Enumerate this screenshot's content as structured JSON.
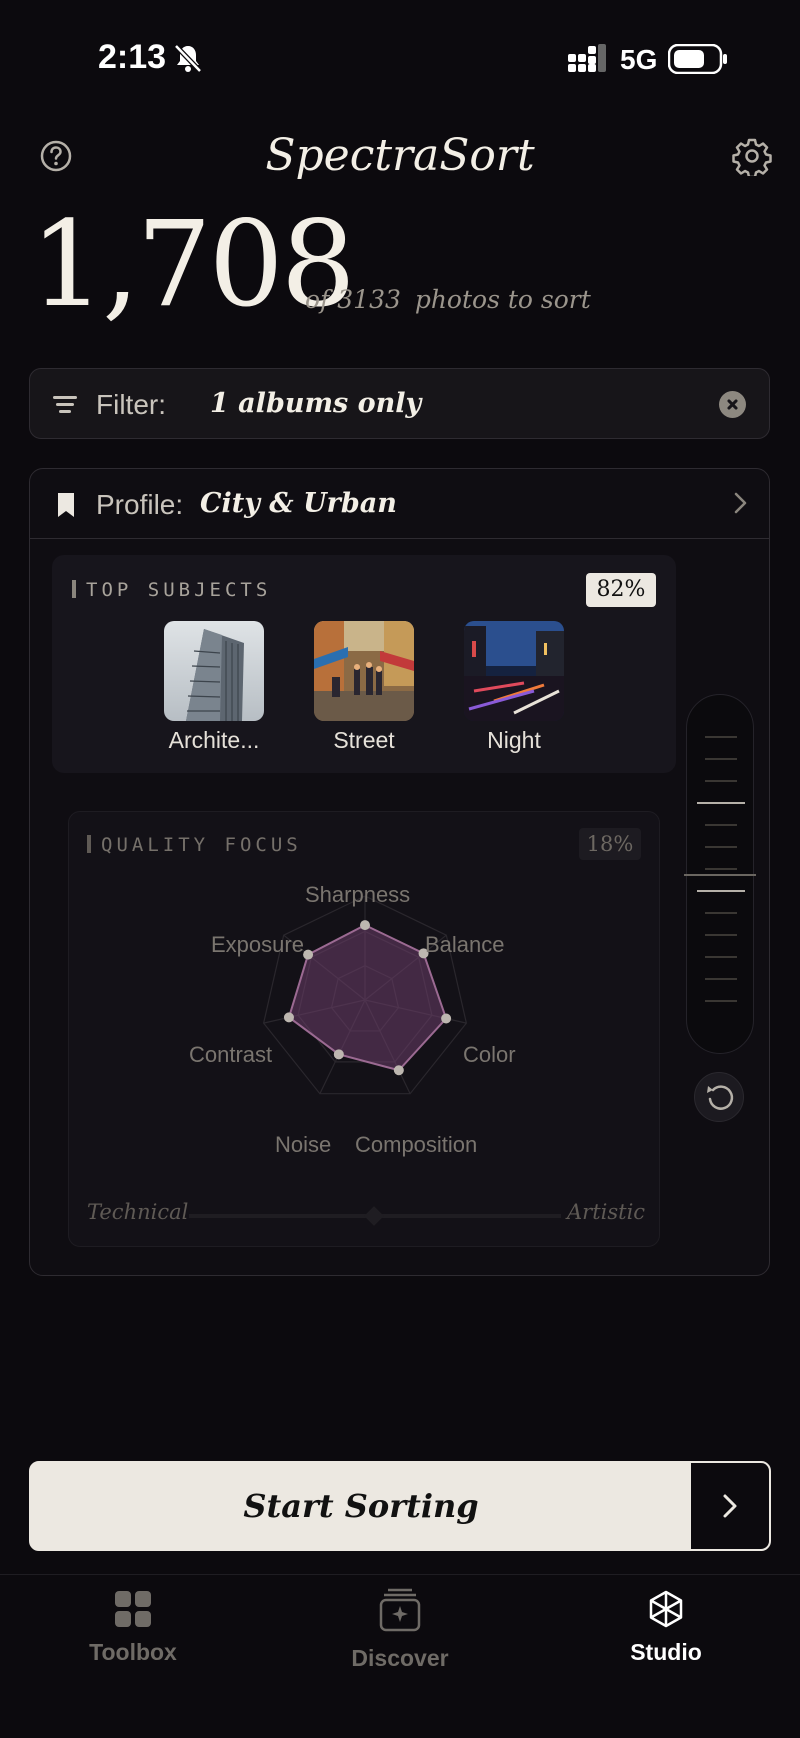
{
  "status": {
    "time": "2:13",
    "network": "5G"
  },
  "header": {
    "title": "SpectraSort"
  },
  "summary": {
    "count": "1,708",
    "of_total": "of 3133",
    "suffix": "photos to sort"
  },
  "filter": {
    "label": "Filter:",
    "value": "1 albums only"
  },
  "profile": {
    "label": "Profile:",
    "value": "City & Urban"
  },
  "top_subjects": {
    "title": "TOP SUBJECTS",
    "percent": "82%",
    "items": [
      {
        "label": "Archite..."
      },
      {
        "label": "Street"
      },
      {
        "label": "Night"
      }
    ]
  },
  "quality_focus": {
    "title": "QUALITY FOCUS",
    "percent": "18%",
    "axes": [
      "Sharpness",
      "Balance",
      "Color",
      "Composition",
      "Noise",
      "Contrast",
      "Exposure"
    ],
    "left_label": "Technical",
    "right_label": "Artistic"
  },
  "primary_action": {
    "label": "Start Sorting"
  },
  "tabs": [
    {
      "label": "Toolbox",
      "icon": "grid-icon"
    },
    {
      "label": "Discover",
      "icon": "stack-sparkle-icon"
    },
    {
      "label": "Studio",
      "icon": "aperture-icon",
      "active": true
    }
  ],
  "colors": {
    "background": "#0c0a0e",
    "cream": "#ece8e1",
    "radar_fill": "#6b3e6a"
  }
}
